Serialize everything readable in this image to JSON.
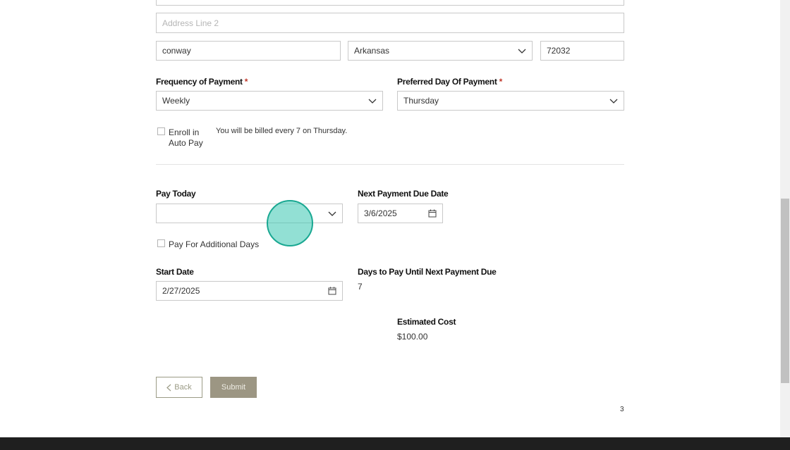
{
  "address": {
    "line2_placeholder": "Address Line 2",
    "city": "conway",
    "state": "Arkansas",
    "zip": "72032"
  },
  "payment": {
    "frequency_label": "Frequency of Payment",
    "frequency_value": "Weekly",
    "preferred_day_label": "Preferred Day Of Payment",
    "preferred_day_value": "Thursday",
    "required_mark": "*",
    "autopay_label_line1": "Enroll in",
    "autopay_label_line2": "Auto Pay",
    "billing_note": "You will be billed every 7 on Thursday."
  },
  "today": {
    "pay_today_label": "Pay Today",
    "pay_today_value": "",
    "next_due_label": "Next Payment Due Date",
    "next_due_value": "3/6/2025",
    "additional_days_label": "Pay For Additional Days",
    "start_date_label": "Start Date",
    "start_date_value": "2/27/2025",
    "days_to_pay_label": "Days to Pay Until Next Payment Due",
    "days_to_pay_value": "7",
    "estimated_cost_label": "Estimated Cost",
    "estimated_cost_value": "$100.00"
  },
  "actions": {
    "back_label": "Back",
    "submit_label": "Submit"
  },
  "page_number": "3",
  "icons": {
    "chevron": "chevron-down-icon",
    "calendar": "calendar-icon",
    "back": "chevron-left-icon"
  },
  "colors": {
    "required": "#c0392b",
    "submit_bg": "#9c9683",
    "cursor": "#38c7b0"
  }
}
